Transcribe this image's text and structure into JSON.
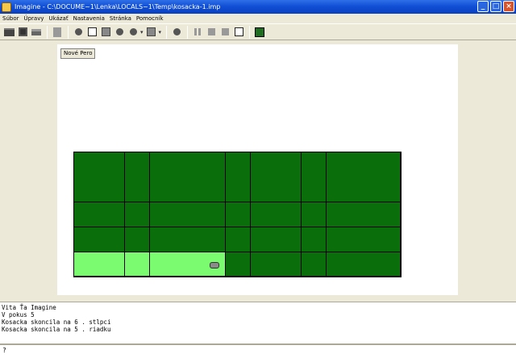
{
  "window": {
    "title": "Imagine - C:\\DOCUME~1\\Lenka\\LOCALS~1\\Temp\\kosacka-1.imp",
    "minimize": "_",
    "maximize": "□",
    "close": "×"
  },
  "menu": [
    "Súbor",
    "Úpravy",
    "Ukázať",
    "Nastavenia",
    "Stránka",
    "Pomocník"
  ],
  "canvas": {
    "new_sheet_button": "Nové Pero"
  },
  "grid": {
    "cell_colors": {
      "dark": "#0a6e0a",
      "light": "#7bfb70"
    },
    "light_cells": [
      [
        3,
        0
      ],
      [
        3,
        1
      ],
      [
        3,
        2
      ]
    ]
  },
  "log": {
    "lines": [
      "Vita Ťa Imagine",
      "V pokus 5",
      "Kosacka skoncila na 6 . stlpci",
      "Kosacka skoncila na 5 . riadku"
    ]
  },
  "command": {
    "prompt": "?"
  },
  "colors": {
    "titlebar": "#1150d6",
    "workspace": "#ece9d8",
    "grid_dark": "#0a6e0a",
    "grid_light": "#7bfb70"
  }
}
